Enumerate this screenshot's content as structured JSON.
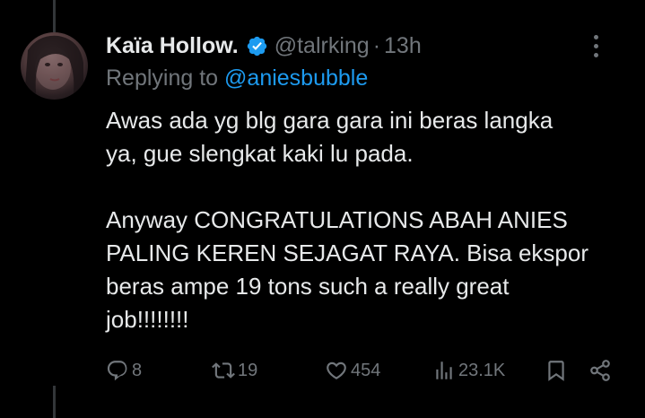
{
  "tweet": {
    "author_name": "Kaïa Hollow.",
    "handle": "@talrking",
    "separator": "·",
    "time": "13h",
    "replying_prefix": "Replying to ",
    "replying_to": "@aniesbubble",
    "paragraph_1_line_1": "Awas ada yg blg gara gara ini beras langka",
    "paragraph_1_line_2": "ya, gue slengkat kaki lu pada.",
    "paragraph_2_line_1": "Anyway CONGRATULATIONS ABAH ANIES",
    "paragraph_2_line_2": "PALING KEREN SEJAGAT RAYA. Bisa ekspor",
    "paragraph_2_line_3": "beras ampe 19 tons such a really great",
    "paragraph_2_line_4": "job!!!!!!!!"
  },
  "actions": {
    "replies": "8",
    "retweets": "19",
    "likes": "454",
    "views": "23.1K"
  },
  "icons": {
    "verified": "verified-badge-icon",
    "more": "more-options-icon",
    "reply": "reply-icon",
    "retweet": "retweet-icon",
    "like": "heart-icon",
    "views": "views-chart-icon",
    "bookmark": "bookmark-icon",
    "share": "share-icon"
  },
  "colors": {
    "background": "#000000",
    "text_primary": "#e7e9ea",
    "text_secondary": "#71767b",
    "accent": "#1d9bf0",
    "thread_line": "#333639"
  }
}
